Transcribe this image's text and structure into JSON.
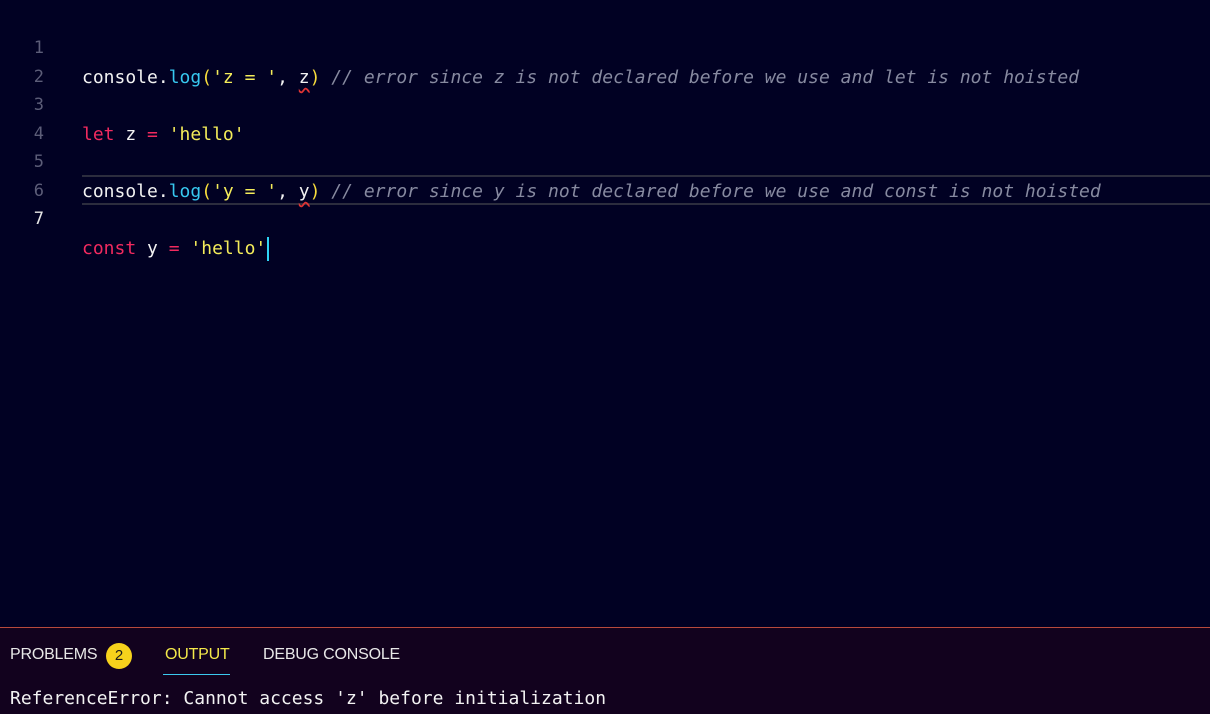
{
  "editor": {
    "lines": [
      {
        "number": "1",
        "t1": "console",
        "t2": ".",
        "t3": "log",
        "t4": "(",
        "t5": "'z = '",
        "t6": ", ",
        "t7": "z",
        "t8": ")",
        "comment": " // error since z is not declared before we use and let is not hoisted"
      },
      {
        "number": "2"
      },
      {
        "number": "3",
        "kw": "let",
        "t1": " z ",
        "op": "=",
        "t2": " ",
        "str": "'hello'"
      },
      {
        "number": "4"
      },
      {
        "number": "5",
        "t1": "console",
        "t2": ".",
        "t3": "log",
        "t4": "(",
        "t5": "'y = '",
        "t6": ", ",
        "t7": "y",
        "t8": ")",
        "comment": " // error since y is not declared before we use and const is not hoisted"
      },
      {
        "number": "6"
      },
      {
        "number": "7",
        "kw": "const",
        "t1": " y ",
        "op": "=",
        "t2": " ",
        "str": "'hello'"
      }
    ]
  },
  "panel": {
    "tabs": {
      "problems": "PROBLEMS",
      "problems_count": "2",
      "output": "OUTPUT",
      "debug": "DEBUG CONSOLE"
    },
    "output_text": "ReferenceError: Cannot access 'z' before initialization"
  },
  "colors": {
    "background": "#010123",
    "keyword": "#f22a5f",
    "function": "#37c8f0",
    "string": "#f4ec5a",
    "comment": "#878aa0",
    "active_tab": "#f4e94a",
    "badge": "#f6d21c"
  }
}
